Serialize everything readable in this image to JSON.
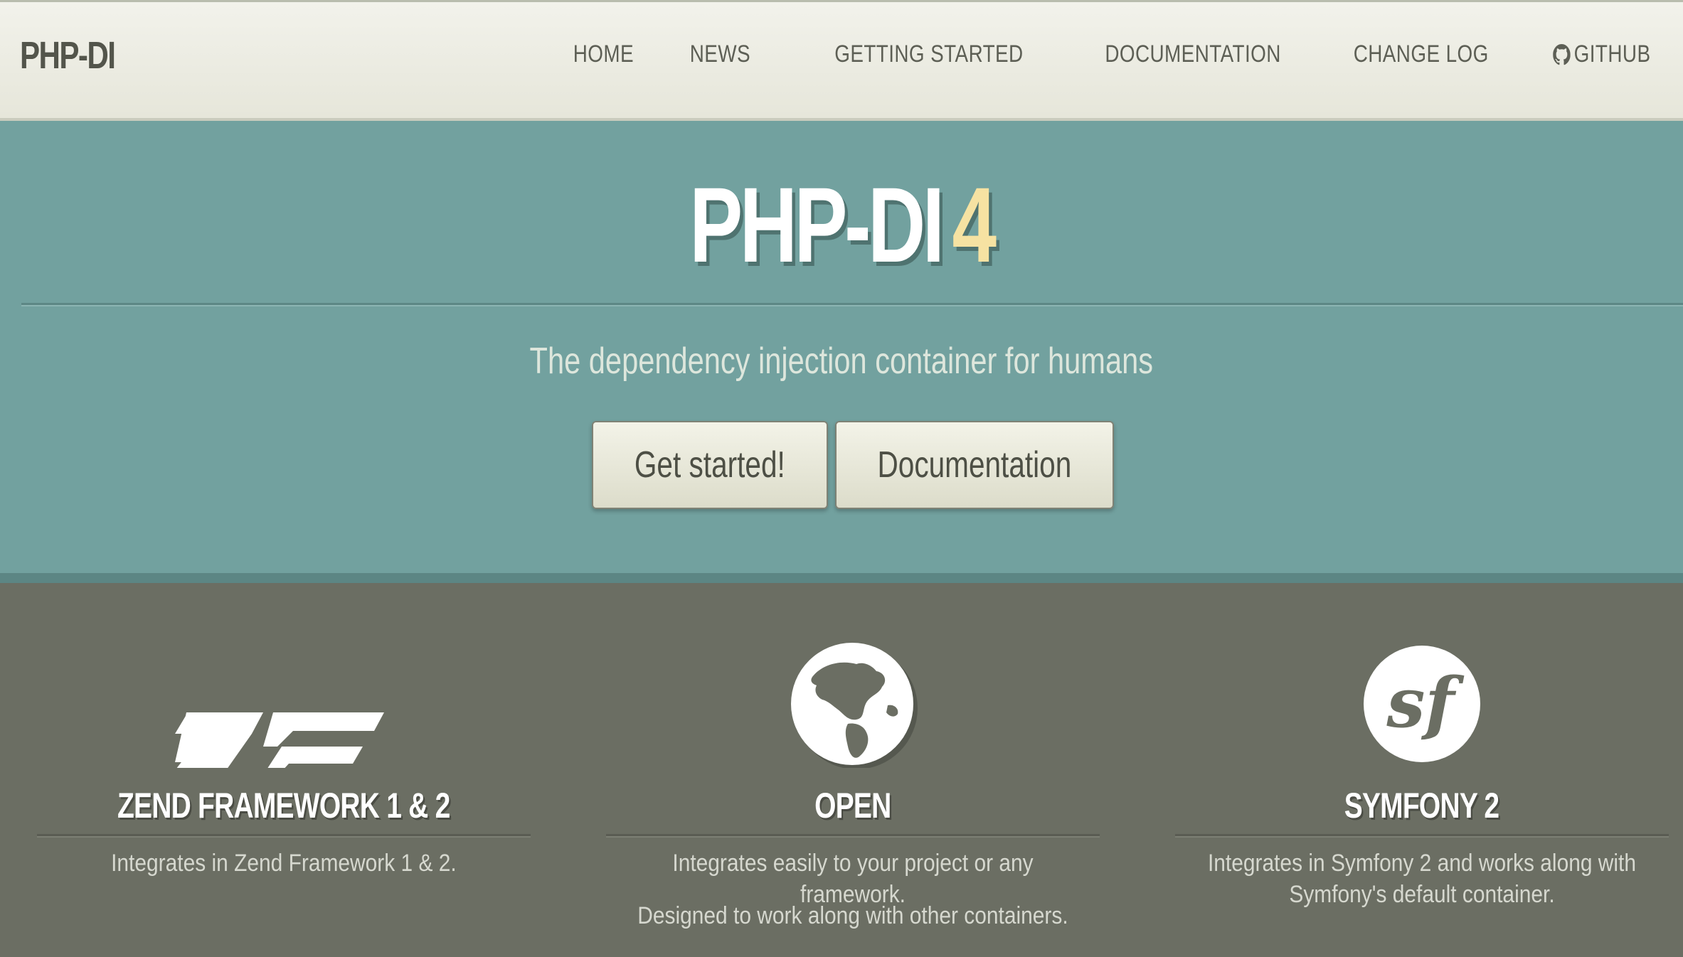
{
  "brand": "PHP-DI",
  "nav": {
    "items": [
      {
        "label": "HOME"
      },
      {
        "label": "NEWS"
      },
      {
        "label": "GETTING STARTED"
      },
      {
        "label": "DOCUMENTATION"
      },
      {
        "label": "CHANGE LOG"
      },
      {
        "label": "GITHUB",
        "icon": "github-icon"
      }
    ]
  },
  "hero": {
    "title": "PHP-DI",
    "version": "4",
    "tagline": "The dependency injection container for humans",
    "primary_button": "Get started!",
    "secondary_button": "Documentation"
  },
  "features": [
    {
      "icon": "zend-framework-logo",
      "title": "ZEND FRAMEWORK 1 & 2",
      "text": "Integrates in Zend Framework 1 & 2.",
      "extra": ""
    },
    {
      "icon": "globe-icon",
      "title": "OPEN",
      "text": "Integrates easily to your project or any framework.",
      "extra": "Designed to work along with other containers."
    },
    {
      "icon": "symfony-logo",
      "title": "SYMFONY 2",
      "text": "Integrates in Symfony 2 and works along with Symfony's default container.",
      "extra": ""
    }
  ],
  "colors": {
    "navbar": "#eaeade",
    "hero": "#72a19f",
    "version_accent": "#f6e2a2",
    "features_bg": "#6b6e63",
    "button": "#e9e9db"
  }
}
